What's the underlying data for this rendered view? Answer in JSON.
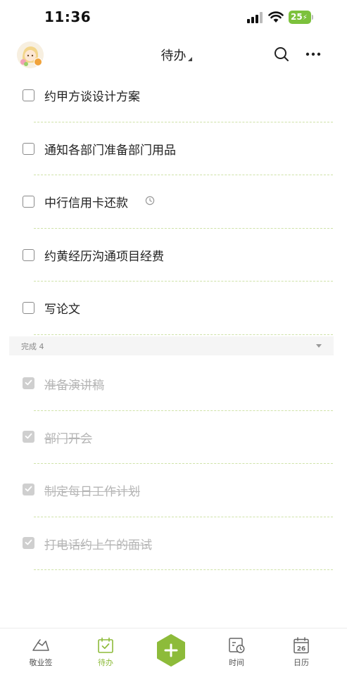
{
  "status_bar": {
    "time": "11:36",
    "battery": "25"
  },
  "header": {
    "title": "待办"
  },
  "tasks": [
    {
      "label": "约甲方谈设计方案",
      "has_reminder": false
    },
    {
      "label": "通知各部门准备部门用品",
      "has_reminder": false
    },
    {
      "label": "中行信用卡还款",
      "has_reminder": true
    },
    {
      "label": "约黄经历沟通项目经费",
      "has_reminder": false
    },
    {
      "label": "写论文",
      "has_reminder": false
    }
  ],
  "completed": {
    "header_label": "完成 4",
    "items": [
      {
        "label": "准备演讲稿"
      },
      {
        "label": "部门开会"
      },
      {
        "label": "制定每日工作计划"
      },
      {
        "label": "打电话约上午的面试"
      }
    ]
  },
  "tab_bar": {
    "items": [
      {
        "label": "敬业签",
        "icon": "note-icon"
      },
      {
        "label": "待办",
        "icon": "todo-icon",
        "active": true
      },
      {
        "label": "",
        "icon": "add-icon"
      },
      {
        "label": "时间",
        "icon": "time-icon"
      },
      {
        "label": "日历",
        "icon": "calendar-icon",
        "date": "26"
      }
    ]
  },
  "colors": {
    "accent": "#8dbb3a",
    "divider": "#cfe2a8",
    "battery": "#7cc13c"
  }
}
